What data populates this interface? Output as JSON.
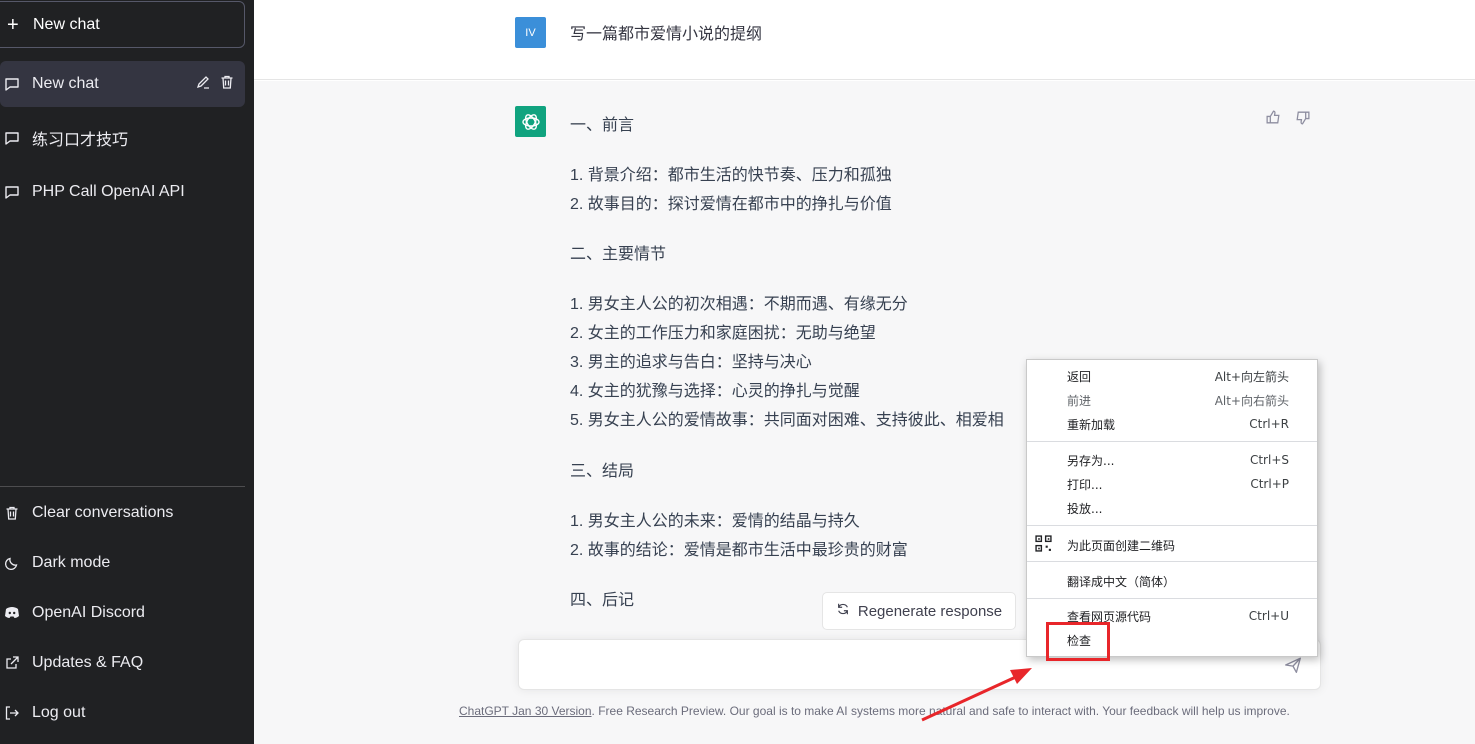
{
  "sidebar": {
    "new_chat": "New chat",
    "conversations": [
      {
        "label": "New chat",
        "active": true
      },
      {
        "label": "练习口才技巧",
        "active": false
      },
      {
        "label": "PHP Call OpenAI API",
        "active": false
      }
    ],
    "bottom": [
      {
        "label": "Clear conversations",
        "icon": "trash-icon"
      },
      {
        "label": "Dark mode",
        "icon": "moon-icon"
      },
      {
        "label": "OpenAI Discord",
        "icon": "discord-icon"
      },
      {
        "label": "Updates & FAQ",
        "icon": "external-link-icon"
      },
      {
        "label": "Log out",
        "icon": "logout-icon"
      }
    ]
  },
  "chat": {
    "user_avatar": "IV",
    "user_message": "写一篇都市爱情小说的提纲",
    "answer": {
      "s1_title": "一、前言",
      "s1_items": [
        "1. 背景介绍：都市生活的快节奏、压力和孤独",
        "2. 故事目的：探讨爱情在都市中的挣扎与价值"
      ],
      "s2_title": "二、主要情节",
      "s2_items": [
        "1. 男女主人公的初次相遇：不期而遇、有缘无分",
        "2. 女主的工作压力和家庭困扰：无助与绝望",
        "3. 男主的追求与告白：坚持与决心",
        "4. 女主的犹豫与选择：心灵的挣扎与觉醒",
        "5. 男女主人公的爱情故事：共同面对困难、支持彼此、相爱相"
      ],
      "s3_title": "三、结局",
      "s3_items": [
        "1. 男女主人公的未来：爱情的结晶与持久",
        "2. 故事的结论：爱情是都市生活中最珍贵的财富"
      ],
      "s4_title": "四、后记"
    }
  },
  "regenerate_label": "Regenerate response",
  "footer": {
    "link": "ChatGPT Jan 30 Version",
    "text": ". Free Research Preview. Our goal is to make AI systems more natural and safe to interact with. Your feedback will help us improve."
  },
  "context_menu": {
    "back": {
      "label": "返回",
      "shortcut": "Alt+向左箭头"
    },
    "forward": {
      "label": "前进",
      "shortcut": "Alt+向右箭头"
    },
    "reload": {
      "label": "重新加载",
      "shortcut": "Ctrl+R"
    },
    "save_as": {
      "label": "另存为...",
      "shortcut": "Ctrl+S"
    },
    "print": {
      "label": "打印...",
      "shortcut": "Ctrl+P"
    },
    "cast": {
      "label": "投放..."
    },
    "qr": {
      "label": "为此页面创建二维码"
    },
    "translate": {
      "label": "翻译成中文（简体）"
    },
    "view_source": {
      "label": "查看网页源代码",
      "shortcut": "Ctrl+U"
    },
    "inspect": {
      "label": "检查"
    }
  },
  "colors": {
    "accent": "#10a37f",
    "highlight": "#e8262a",
    "sidebar": "#202123"
  }
}
